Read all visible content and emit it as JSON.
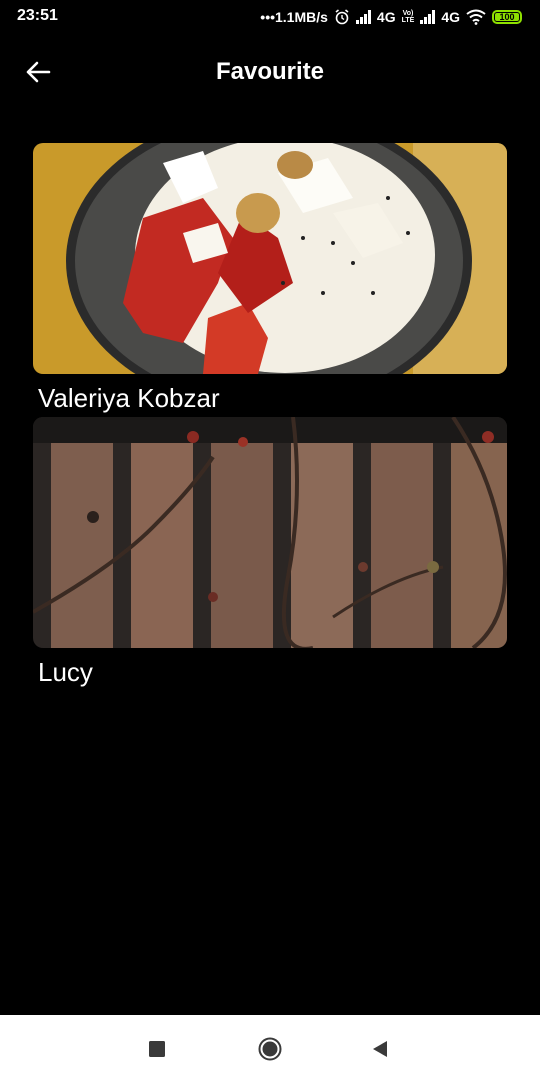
{
  "status_bar": {
    "time": "23:51",
    "net_speed": "•••1.1MB/s",
    "network_1": "4G",
    "volte_top": "Vo)",
    "volte_bottom": "LTE",
    "network_2": "4G",
    "battery_level": "100",
    "battery_color": "#8ee000"
  },
  "header": {
    "back_icon": "arrow-left-icon",
    "title": "Favourite"
  },
  "favourites": [
    {
      "name": "Valeriya Kobzar",
      "image": "bowl of yogurt with strawberries, coconut chips and chia seeds"
    },
    {
      "name": "Lucy",
      "image": "shadows of flowering branches on a wooden fence"
    }
  ],
  "nav_bar": {
    "recents_icon": "square-icon",
    "home_icon": "circle-icon",
    "back_icon": "triangle-back-icon"
  }
}
